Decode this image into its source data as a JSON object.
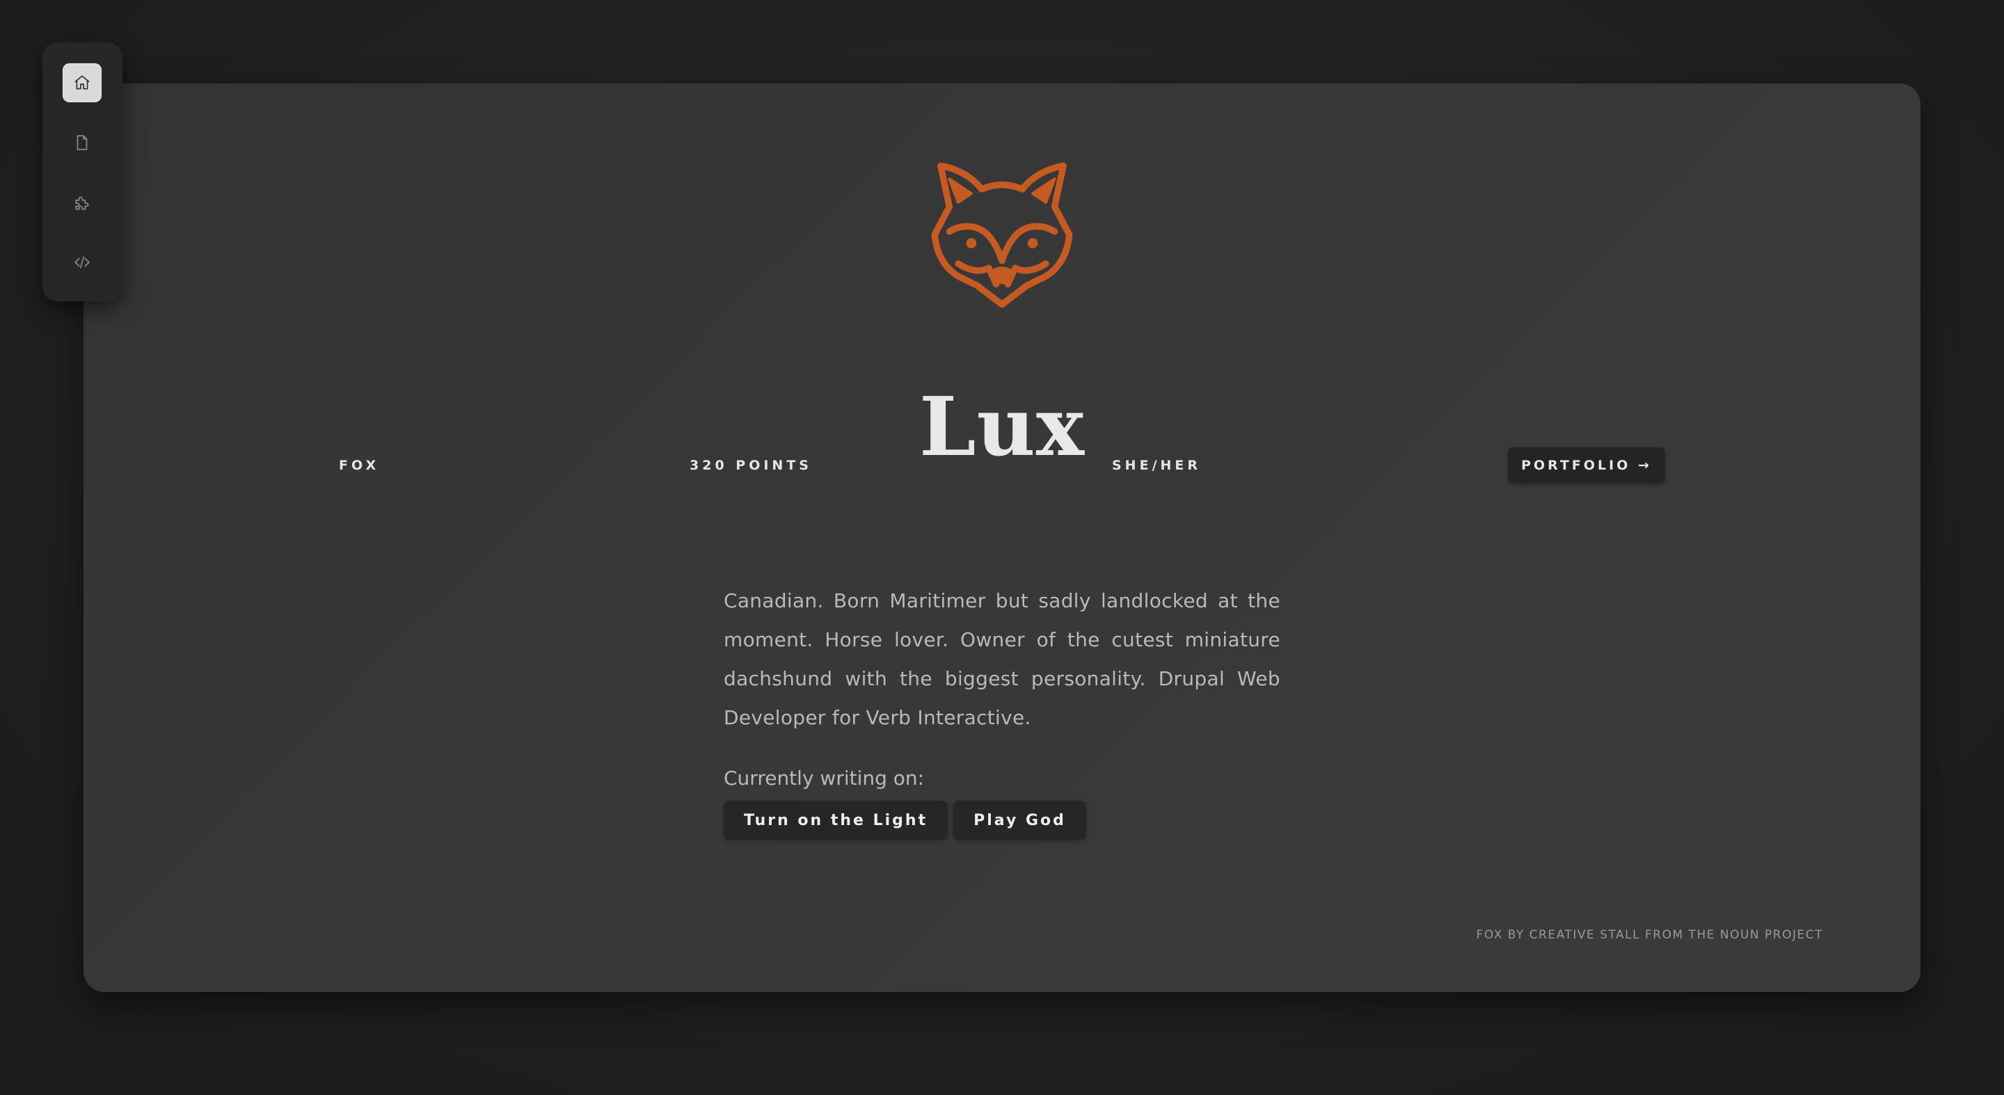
{
  "sidebar": {
    "items": [
      {
        "icon": "home-icon",
        "label": "Home",
        "active": true
      },
      {
        "icon": "document-icon",
        "label": "Documents",
        "active": false
      },
      {
        "icon": "puzzle-icon",
        "label": "Extensions",
        "active": false
      },
      {
        "icon": "code-icon",
        "label": "Code",
        "active": false
      }
    ]
  },
  "profile": {
    "logo_icon": "fox-icon",
    "accent_color": "#c55a22",
    "name": "Lux",
    "species": "FOX",
    "points": "320 POINTS",
    "pronouns": "SHE/HER",
    "portfolio_label": "PORTFOLIO →",
    "bio": "Canadian. Born Maritimer but sadly landlocked at the moment. Horse lover. Owner of the cutest miniature dachshund with the biggest personality. Drupal Web Developer for Verb Interactive.",
    "writing_label": "Currently writing on:",
    "writing_projects": [
      "Turn on the Light",
      "Play God"
    ],
    "credit": "FOX BY CREATIVE STALL FROM THE NOUN PROJECT"
  }
}
